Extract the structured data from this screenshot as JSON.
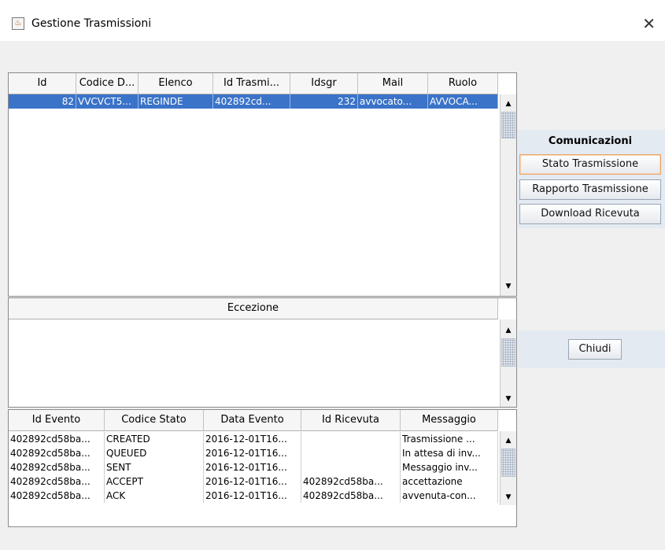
{
  "window": {
    "title": "Gestione Trasmissioni",
    "close_glyph": "✕",
    "icon": "java-cup-icon"
  },
  "top_table": {
    "columns": [
      "Id",
      "Codice D...",
      "Elenco",
      "Id Trasmi...",
      "Idsgr",
      "Mail",
      "Ruolo"
    ],
    "rows": [
      [
        "82",
        "VVCVCT5...",
        "REGINDE",
        "402892cd...",
        "232",
        "avvocato...",
        "AVVOCA..."
      ]
    ]
  },
  "middle_table": {
    "columns": [
      "Eccezione"
    ],
    "rows": []
  },
  "bottom_table": {
    "columns": [
      "Id Evento",
      "Codice Stato",
      "Data Evento",
      "Id Ricevuta",
      "Messaggio"
    ],
    "rows": [
      [
        "402892cd58ba...",
        "CREATED",
        "2016-12-01T16...",
        "",
        "Trasmissione ..."
      ],
      [
        "402892cd58ba...",
        "QUEUED",
        "2016-12-01T16...",
        "",
        "In attesa di inv..."
      ],
      [
        "402892cd58ba...",
        "SENT",
        "2016-12-01T16...",
        "",
        "Messaggio inv..."
      ],
      [
        "402892cd58ba...",
        "ACCEPT",
        "2016-12-01T16...",
        "402892cd58ba...",
        "accettazione"
      ],
      [
        "402892cd58ba...",
        "ACK",
        "2016-12-01T16...",
        "402892cd58ba...",
        "avvenuta-con..."
      ]
    ]
  },
  "side": {
    "section_label": "Comunicazioni",
    "buttons": [
      "Stato Trasmissione",
      "Rapporto Trasmissione",
      "Download Ricevuta"
    ],
    "close_button": "Chiudi"
  },
  "scroll_glyphs": {
    "up": "▲",
    "down": "▼"
  }
}
